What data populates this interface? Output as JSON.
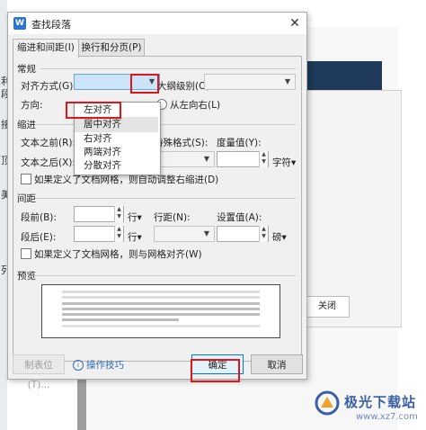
{
  "window": {
    "title": "查找段落",
    "app_icon_letter": "W"
  },
  "tabs": [
    {
      "label": "缩进和间距(I)",
      "active": true
    },
    {
      "label": "换行和分页(P)",
      "active": false
    }
  ],
  "general": {
    "section": "常规",
    "alignment_label": "对齐方式(G):",
    "alignment_value": "",
    "outline_label": "大纲级别(O):",
    "direction_label": "方向:",
    "rtl_label": "从左向右(L)"
  },
  "alignment_dropdown": {
    "options": [
      "左对齐",
      "居中对齐",
      "右对齐",
      "两端对齐",
      "分散对齐"
    ],
    "highlighted_index": 1
  },
  "indent": {
    "section": "缩进",
    "before_label": "文本之前(R):",
    "after_label": "文本之后(X):",
    "special_label": "特殊格式(S):",
    "measure_label": "度量值(Y):",
    "unit": "字符▾",
    "grid_checkbox_label": "如果定义了文档网格，则自动调整右缩进(D)"
  },
  "spacing": {
    "section": "间距",
    "before_label": "段前(B):",
    "before_unit": "行▾",
    "after_label": "段后(E):",
    "after_unit": "行▾",
    "line_spacing_label": "行距(N):",
    "setting_label": "设置值(A):",
    "setting_unit": "磅▾",
    "grid_checkbox_label": "如果定义了文档网格，则与网格对齐(W)"
  },
  "preview": {
    "section": "预览"
  },
  "footer": {
    "tabs_button": "制表位(T)...",
    "tips_link": "操作技巧",
    "ok_button": "确定",
    "cancel_button": "取消"
  },
  "background": {
    "close_button": "关闭",
    "partial_chars": [
      "利",
      "段",
      "接",
      "顶",
      "美",
      "列"
    ]
  },
  "watermark": {
    "text": "极光下载站",
    "url": "www.xz7.com"
  },
  "colors": {
    "highlight_red": "#e0161b",
    "accent_blue": "#2b72d6"
  }
}
